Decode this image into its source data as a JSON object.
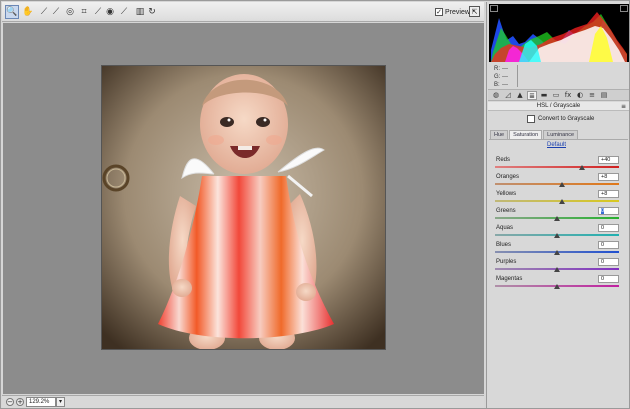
{
  "toolbar": {
    "tools": [
      {
        "name": "zoom-tool",
        "icon": "zoom-icon",
        "glyph": "🔍"
      },
      {
        "name": "hand-tool",
        "icon": "hand-icon",
        "glyph": "✋"
      },
      {
        "name": "white-balance-tool",
        "icon": "eyedropper-icon",
        "glyph": "⟋"
      },
      {
        "name": "color-sampler-tool",
        "icon": "color-sampler-icon",
        "glyph": "⟋"
      },
      {
        "name": "targeted-adjustment-tool",
        "icon": "target-icon",
        "glyph": "◎"
      },
      {
        "name": "crop-tool",
        "icon": "crop-icon",
        "glyph": "⌗"
      },
      {
        "name": "straighten-tool",
        "icon": "straighten-icon",
        "glyph": "⟋"
      },
      {
        "name": "red-eye-tool",
        "icon": "eye-icon",
        "glyph": "◉"
      },
      {
        "name": "brush-tool",
        "icon": "brush-icon",
        "glyph": "⟋"
      },
      {
        "name": "delete-tool",
        "icon": "trash-icon",
        "glyph": "▥"
      },
      {
        "name": "rotate-tool",
        "icon": "rotate-icon",
        "glyph": "↻"
      }
    ],
    "preview_label": "Preview",
    "preview_checked": "✓"
  },
  "status": {
    "zoom_out": "−",
    "zoom_in": "+",
    "zoom_value": "129.2%",
    "zoom_dropdown": "▾"
  },
  "info": {
    "r_label": "R:",
    "r_value": "---",
    "g_label": "G:",
    "g_value": "---",
    "b_label": "B:",
    "b_value": "---"
  },
  "panel": {
    "section_title": "HSL / Grayscale",
    "menu_glyph": "≡",
    "convert_label": "Convert to Grayscale",
    "tabs": [
      "Hue",
      "Saturation",
      "Luminance"
    ],
    "selected_tab": "Saturation",
    "default_link": "Default",
    "rows": [
      {
        "label": "Reds",
        "value": "+40",
        "pos": 0.7,
        "c1": "#d02020",
        "c2": "#e08080"
      },
      {
        "label": "Oranges",
        "value": "+8",
        "pos": 0.54,
        "c1": "#e07818",
        "c2": "#c09070"
      },
      {
        "label": "Yellows",
        "value": "+8",
        "pos": 0.54,
        "c1": "#d8c820",
        "c2": "#c0b878"
      },
      {
        "label": "Greens",
        "value": "0",
        "pos": 0.5,
        "c1": "#28b030",
        "c2": "#8aa88a"
      },
      {
        "label": "Aquas",
        "value": "0",
        "pos": 0.5,
        "c1": "#20b0b0",
        "c2": "#88a8a8"
      },
      {
        "label": "Blues",
        "value": "0",
        "pos": 0.5,
        "c1": "#2050d0",
        "c2": "#8890b0"
      },
      {
        "label": "Purples",
        "value": "0",
        "pos": 0.5,
        "c1": "#8030c0",
        "c2": "#a08cb0"
      },
      {
        "label": "Magentas",
        "value": "0",
        "pos": 0.5,
        "c1": "#c020a0",
        "c2": "#b090a8"
      }
    ]
  },
  "icon_tabs": [
    "basic-icon",
    "tone-curve-icon",
    "detail-icon",
    "hsl-icon",
    "split-toning-icon",
    "lens-icon",
    "fx-icon",
    "camera-calibration-icon",
    "presets-icon",
    "snapshots-icon"
  ],
  "icon_tab_glyphs": [
    "◍",
    "◿",
    "▲",
    "≣",
    "▬",
    "▭",
    "fx",
    "◐",
    "≡",
    "▤"
  ]
}
